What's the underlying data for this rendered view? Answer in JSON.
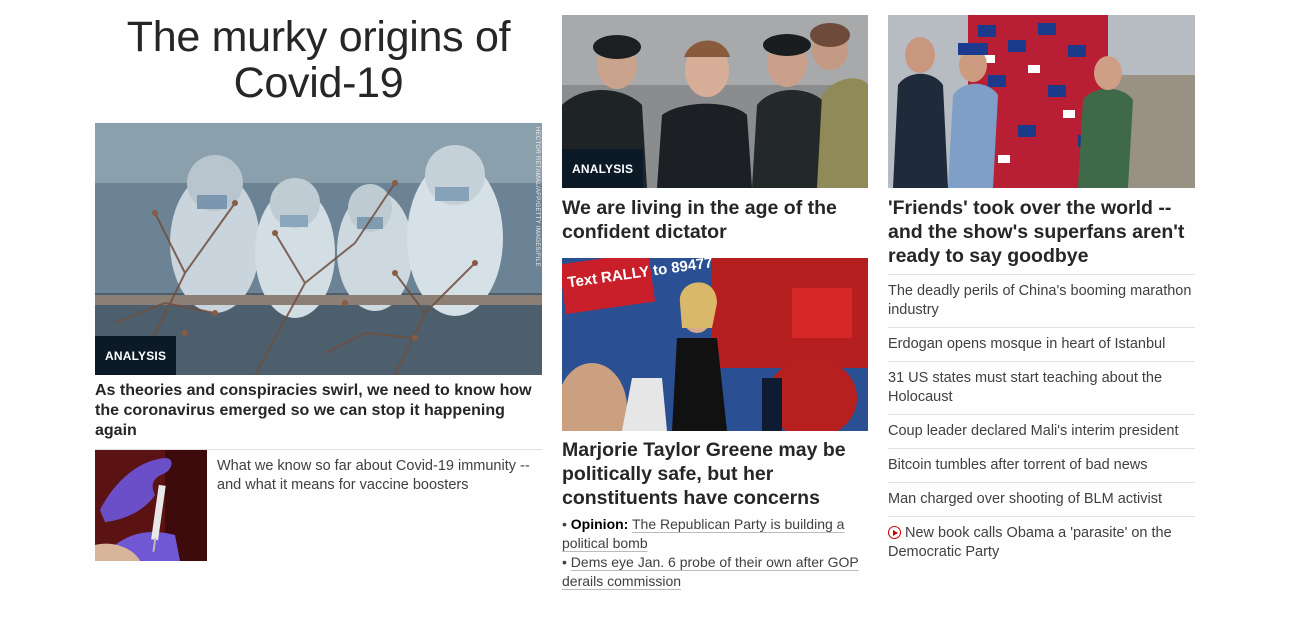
{
  "col1": {
    "title": "The murky origins of Covid-19",
    "hero_badge": "ANALYSIS",
    "hero_credit": "HECTOR RETAMAL/AFP/GETTY IMAGES/FILE",
    "hero_caption": "As theories and conspiracies swirl, we need to know how the coronavirus emerged so we can stop it happening again",
    "small_story": "What we know so far about Covid-19 immunity -- and what it means for vaccine boosters"
  },
  "col2": {
    "top_badge": "ANALYSIS",
    "top_headline": "We are living in the age of the confident dictator",
    "rally_sign": "Text RALLY to 89477",
    "mid_headline": "Marjorie Taylor Greene may be politically safe, but her constituents have concerns",
    "bullets": [
      {
        "prefix": "Opinion:",
        "text": "The Republican Party is building a political bomb"
      },
      {
        "prefix": "",
        "text": "Dems eye Jan. 6 probe of their own after GOP derails commission"
      }
    ]
  },
  "col3": {
    "top_headline": "'Friends' took over the world -- and the show's superfans aren't ready to say goodbye",
    "items": [
      {
        "text": "The deadly perils of China's booming marathon industry",
        "video": false
      },
      {
        "text": "Erdogan opens mosque in heart of Istanbul",
        "video": false
      },
      {
        "text": "31 US states must start teaching about the Holocaust",
        "video": false
      },
      {
        "text": "Coup leader declared Mali's interim president",
        "video": false
      },
      {
        "text": "Bitcoin tumbles after torrent of bad news",
        "video": false
      },
      {
        "text": "Man charged over shooting of BLM activist",
        "video": false
      },
      {
        "text": "New book calls Obama a 'parasite' on the Democratic Party",
        "video": true
      }
    ]
  },
  "colors": {
    "badge_bg": "#0c1a28",
    "video_icon": "#cc0000",
    "divider": "#e1e1e1"
  }
}
